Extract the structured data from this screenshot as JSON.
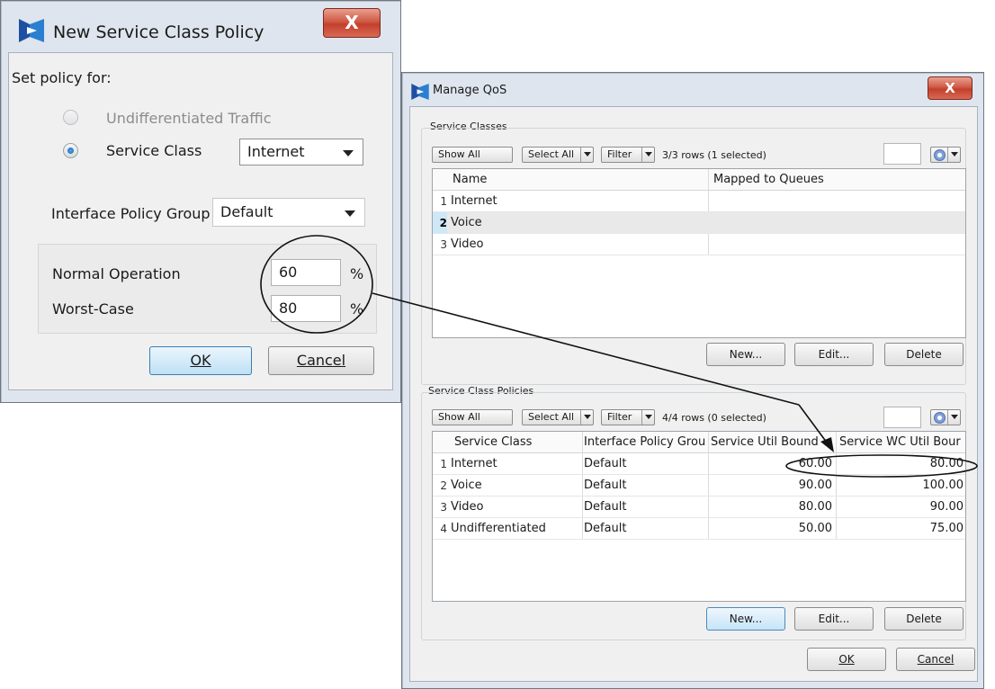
{
  "new_policy_dialog": {
    "title": "New Service Class Policy",
    "close_label": "X",
    "set_policy_for_label": "Set policy for:",
    "undifferentiated_option": "Undifferentiated Traffic",
    "service_class_option": "Service Class",
    "service_class_value": "Internet",
    "interface_policy_group_label": "Interface Policy Group",
    "interface_policy_group_value": "Default",
    "normal_operation_label": "Normal Operation",
    "normal_operation_value": "60",
    "worst_case_label": "Worst-Case",
    "worst_case_value": "80",
    "percent_unit": "%",
    "ok_label": "OK",
    "cancel_label": "Cancel"
  },
  "manage_qos": {
    "title": "Manage QoS",
    "close_label": "X",
    "service_classes": {
      "section_title": "Service Classes",
      "show_all": "Show All",
      "select_all": "Select All",
      "filter": "Filter",
      "rows_status": "3/3 rows (1 selected)",
      "columns": [
        "Name",
        "Mapped to Queues"
      ],
      "rows": [
        {
          "num": "1",
          "name": "Internet",
          "queues": ""
        },
        {
          "num": "2",
          "name": "Voice",
          "queues": ""
        },
        {
          "num": "3",
          "name": "Video",
          "queues": ""
        }
      ],
      "new_label": "New...",
      "edit_label": "Edit...",
      "delete_label": "Delete"
    },
    "service_class_policies": {
      "section_title": "Service Class Policies",
      "show_all": "Show All",
      "select_all": "Select All",
      "filter": "Filter",
      "rows_status": "4/4 rows (0 selected)",
      "columns": [
        "Service Class",
        "Interface Policy Grou",
        "Service Util Bound",
        "Service WC Util Bour"
      ],
      "rows": [
        {
          "num": "1",
          "service_class": "Internet",
          "group": "Default",
          "util": "60.00",
          "wc_util": "80.00"
        },
        {
          "num": "2",
          "service_class": "Voice",
          "group": "Default",
          "util": "90.00",
          "wc_util": "100.00"
        },
        {
          "num": "3",
          "service_class": "Video",
          "group": "Default",
          "util": "80.00",
          "wc_util": "90.00"
        },
        {
          "num": "4",
          "service_class": "Undifferentiated",
          "group": "Default",
          "util": "50.00",
          "wc_util": "75.00"
        }
      ],
      "new_label": "New...",
      "edit_label": "Edit...",
      "delete_label": "Delete"
    },
    "ok_label": "OK",
    "cancel_label": "Cancel"
  },
  "colors": {
    "selected_row": "#e9e9e9",
    "row_number_selected": "#cfe8f8",
    "annotation": "#000000"
  }
}
